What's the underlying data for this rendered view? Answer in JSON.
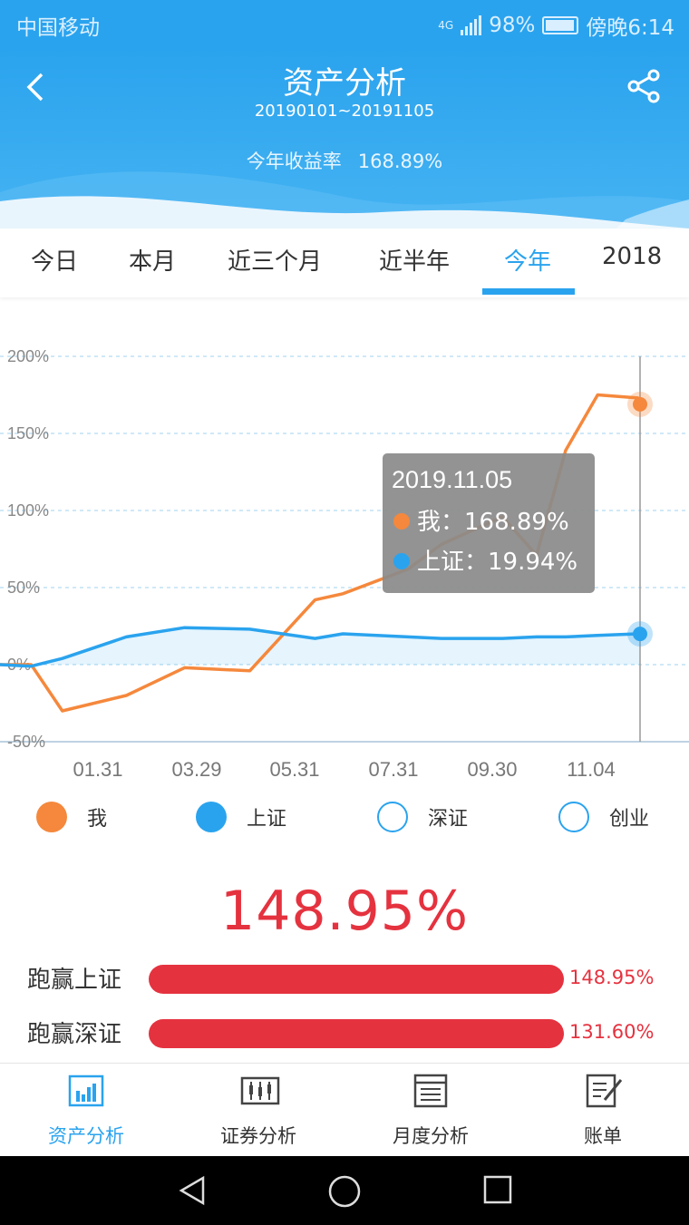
{
  "status_bar": {
    "carrier": "中国移动",
    "network": "4G",
    "battery": "98%",
    "time": "傍晚6:14"
  },
  "header": {
    "title": "资产分析",
    "date_range": "20190101~20191105",
    "return_label": "今年收益率",
    "return_value": "168.89%",
    "back_icon": "chevron-left-icon",
    "share_icon": "share-icon"
  },
  "tabs": [
    {
      "label": "今日",
      "active": false
    },
    {
      "label": "本月",
      "active": false
    },
    {
      "label": "近三个月",
      "active": false
    },
    {
      "label": "近半年",
      "active": false
    },
    {
      "label": "今年",
      "active": true
    },
    {
      "label": "2018",
      "active": false
    }
  ],
  "colors": {
    "brand": "#2aa3ee",
    "me": "#f5883c",
    "shanghai": "#2aa3ee",
    "accent_red": "#e5323f"
  },
  "chart_data": {
    "type": "line",
    "x_ticks": [
      "01.31",
      "03.29",
      "05.31",
      "07.31",
      "09.30",
      "11.04"
    ],
    "y_ticks": [
      "200%",
      "150%",
      "100%",
      "50%",
      "0%",
      "-50%"
    ],
    "ylim": [
      -50,
      200
    ],
    "grid": true,
    "x": [
      "01.01",
      "01.16",
      "01.31",
      "03.01",
      "03.29",
      "04.30",
      "05.31",
      "06.14",
      "07.15",
      "07.31",
      "08.30",
      "09.16",
      "09.30",
      "10.15",
      "11.04",
      "11.05"
    ],
    "series": [
      {
        "name": "我",
        "color": "#f5883c",
        "values": [
          0,
          0,
          -30,
          -20,
          -2,
          -4,
          42,
          46,
          62,
          78,
          96,
          71,
          139,
          175,
          173,
          168.89
        ]
      },
      {
        "name": "上证",
        "color": "#2aa3ee",
        "values": [
          0,
          -1,
          4,
          18,
          24,
          23,
          17,
          20,
          18,
          17,
          17,
          18,
          18,
          19,
          20,
          19.94
        ]
      }
    ],
    "tooltip": {
      "date": "2019.11.05",
      "rows": [
        {
          "label": "我：",
          "value": "168.89%",
          "color": "#f5883c"
        },
        {
          "label": "上证：",
          "value": "19.94%",
          "color": "#2aa3ee"
        }
      ]
    }
  },
  "legend": [
    {
      "label": "我",
      "filled": true,
      "color": "#f5883c"
    },
    {
      "label": "上证",
      "filled": true,
      "color": "#2aa3ee"
    },
    {
      "label": "深证",
      "filled": false,
      "color": "#2aa3ee"
    },
    {
      "label": "创业",
      "filled": false,
      "color": "#2aa3ee"
    }
  ],
  "summary": {
    "headline": "148.95%",
    "rows": [
      {
        "label": "跑赢上证",
        "value": "148.95%",
        "fill": 1.0
      },
      {
        "label": "跑赢深证",
        "value": "131.60%",
        "fill": 1.0
      }
    ]
  },
  "bottom_nav": [
    {
      "label": "资产分析",
      "icon": "bar-chart-icon",
      "active": true
    },
    {
      "label": "证券分析",
      "icon": "candlestick-icon",
      "active": false
    },
    {
      "label": "月度分析",
      "icon": "calendar-list-icon",
      "active": false
    },
    {
      "label": "账单",
      "icon": "edit-document-icon",
      "active": false
    }
  ],
  "system_nav": {
    "icons": [
      "back-triangle-icon",
      "home-circle-icon",
      "recents-square-icon"
    ]
  }
}
